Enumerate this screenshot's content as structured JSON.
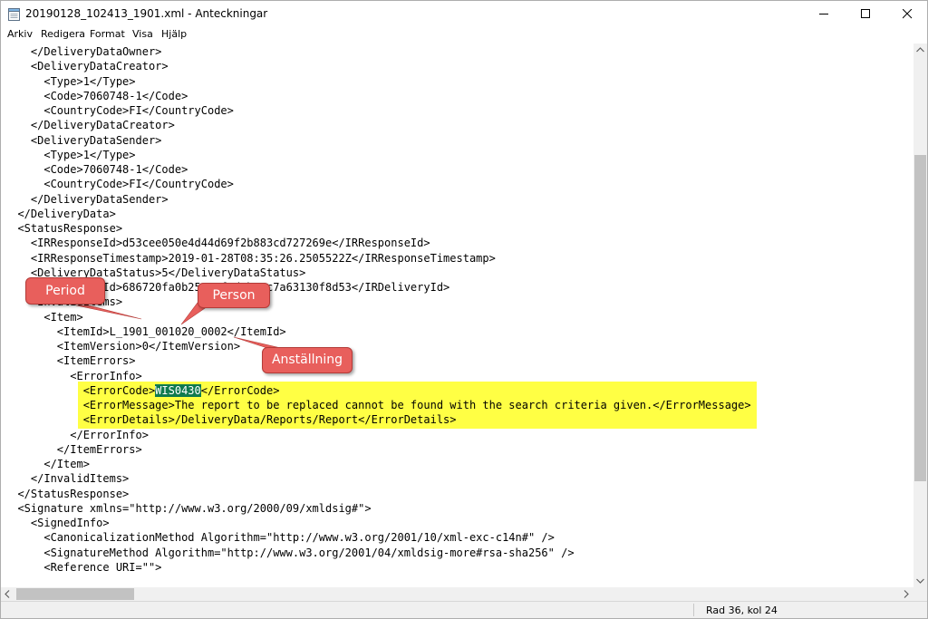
{
  "window": {
    "title": "20190128_102413_1901.xml - Anteckningar",
    "icon": "notepad-icon",
    "controls": [
      "minimize-icon",
      "maximize-icon",
      "close-icon"
    ]
  },
  "menu": {
    "items": [
      "Arkiv",
      "Redigera",
      "Format",
      "Visa",
      "Hjälp"
    ]
  },
  "editor": {
    "lines": [
      "    </DeliveryDataOwner>",
      "    <DeliveryDataCreator>",
      "      <Type>1</Type>",
      "      <Code>7060748-1</Code>",
      "      <CountryCode>FI</CountryCode>",
      "    </DeliveryDataCreator>",
      "    <DeliveryDataSender>",
      "      <Type>1</Type>",
      "      <Code>7060748-1</Code>",
      "      <CountryCode>FI</CountryCode>",
      "    </DeliveryDataSender>",
      "  </DeliveryData>",
      "  <StatusResponse>",
      "    <IRResponseId>d53cee050e4d44d69f2b883cd727269e</IRResponseId>",
      "    <IRResponseTimestamp>2019-01-28T08:35:26.2505522Z</IRResponseTimestamp>",
      "    <DeliveryDataStatus>5</DeliveryDataStatus>",
      "    <IRDeliveryId>686720fa0b254a6f8d2ba5c7a63130f8d53</IRDeliveryId>",
      "    <InvalidItems>",
      "      <Item>",
      "        <ItemId>L_1901_001020_0002</ItemId>",
      "        <ItemVersion>0</ItemVersion>",
      "        <ItemErrors>",
      "          <ErrorInfo>",
      "            <ErrorCode>WIS0430</ErrorCode>",
      "            <ErrorMessage>The report to be replaced cannot be found with the search criteria given.</ErrorMessage>",
      "            <ErrorDetails>/DeliveryData/Reports/Report</ErrorDetails>",
      "          </ErrorInfo>",
      "        </ItemErrors>",
      "      </Item>",
      "    </InvalidItems>",
      "  </StatusResponse>",
      "  <Signature xmlns=\"http://www.w3.org/2000/09/xmldsig#\">",
      "    <SignedInfo>",
      "      <CanonicalizationMethod Algorithm=\"http://www.w3.org/2001/10/xml-exc-c14n#\" />",
      "      <SignatureMethod Algorithm=\"http://www.w3.org/2001/04/xmldsig-more#rsa-sha256\" />",
      "      <Reference URI=\"\">"
    ],
    "selection": {
      "line": 23,
      "before": "            <ErrorCode>",
      "selected": "WIS0430",
      "after": "</ErrorCode>"
    },
    "highlight_color": "#ffff44",
    "selection_color": "#0f7a4e"
  },
  "callouts": [
    {
      "label": "Period"
    },
    {
      "label": "Person"
    },
    {
      "label": "Anställning"
    }
  ],
  "callout_color": "#e85f5c",
  "statusbar": {
    "position": "Rad 36, kol 24"
  }
}
